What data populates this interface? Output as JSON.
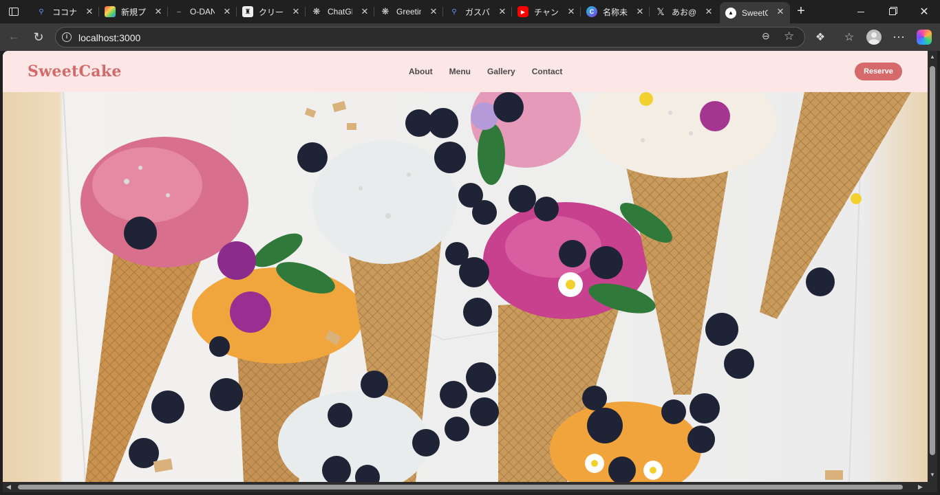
{
  "browser": {
    "tabs": [
      {
        "label": "ココナラ",
        "favicon": "search-icon",
        "fav_color": "#1f5fbf"
      },
      {
        "label": "新規プロ",
        "favicon": "notion-icon",
        "fav_color": "#4caf50"
      },
      {
        "label": "O-DAN",
        "favicon": "dash-icon",
        "fav_color": "#202020"
      },
      {
        "label": "クリーム",
        "favicon": "crown-icon",
        "fav_color": "#111111"
      },
      {
        "label": "ChatGPT",
        "favicon": "openai-icon",
        "fav_color": "#202020"
      },
      {
        "label": "Greeting",
        "favicon": "openai-icon",
        "fav_color": "#202020"
      },
      {
        "label": "ガスバル",
        "favicon": "search-icon",
        "fav_color": "#1f5fbf"
      },
      {
        "label": "チャンネ",
        "favicon": "youtube-icon",
        "fav_color": "#ff0000"
      },
      {
        "label": "名称未設",
        "favicon": "canva-icon",
        "fav_color": "#2f7de1"
      },
      {
        "label": "あお@w",
        "favicon": "x-icon",
        "fav_color": "#000000"
      },
      {
        "label": "SweetC",
        "favicon": "vercel-icon",
        "fav_color": "#000000",
        "active": true
      }
    ],
    "url": "localhost:3000",
    "accent": "#d66a6a"
  },
  "site": {
    "logo": "SweetCake",
    "nav": [
      "About",
      "Menu",
      "Gallery",
      "Contact"
    ],
    "cta": "Reserve",
    "colors": {
      "header_bg": "#fde7e6",
      "logo": "#d26a6a",
      "button": "#d66a6a"
    }
  },
  "hero": {
    "image": "ice cream cones with blueberries and flowers"
  }
}
